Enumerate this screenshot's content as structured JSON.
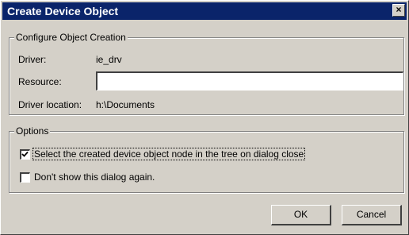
{
  "window": {
    "title": "Create Device Object",
    "close_glyph": "×"
  },
  "config_group": {
    "legend": "Configure Object Creation",
    "driver_label": "Driver:",
    "driver_value": "ie_drv",
    "resource_label": "Resource:",
    "resource_value": "",
    "location_label": "Driver location:",
    "location_value": "h:\\Documents"
  },
  "options_group": {
    "legend": "Options",
    "select_node_label": "Select the created device object node in the tree on dialog close",
    "select_node_checked": true,
    "dont_show_label": "Don't show this dialog again.",
    "dont_show_checked": false
  },
  "buttons": {
    "ok": "OK",
    "cancel": "Cancel"
  }
}
